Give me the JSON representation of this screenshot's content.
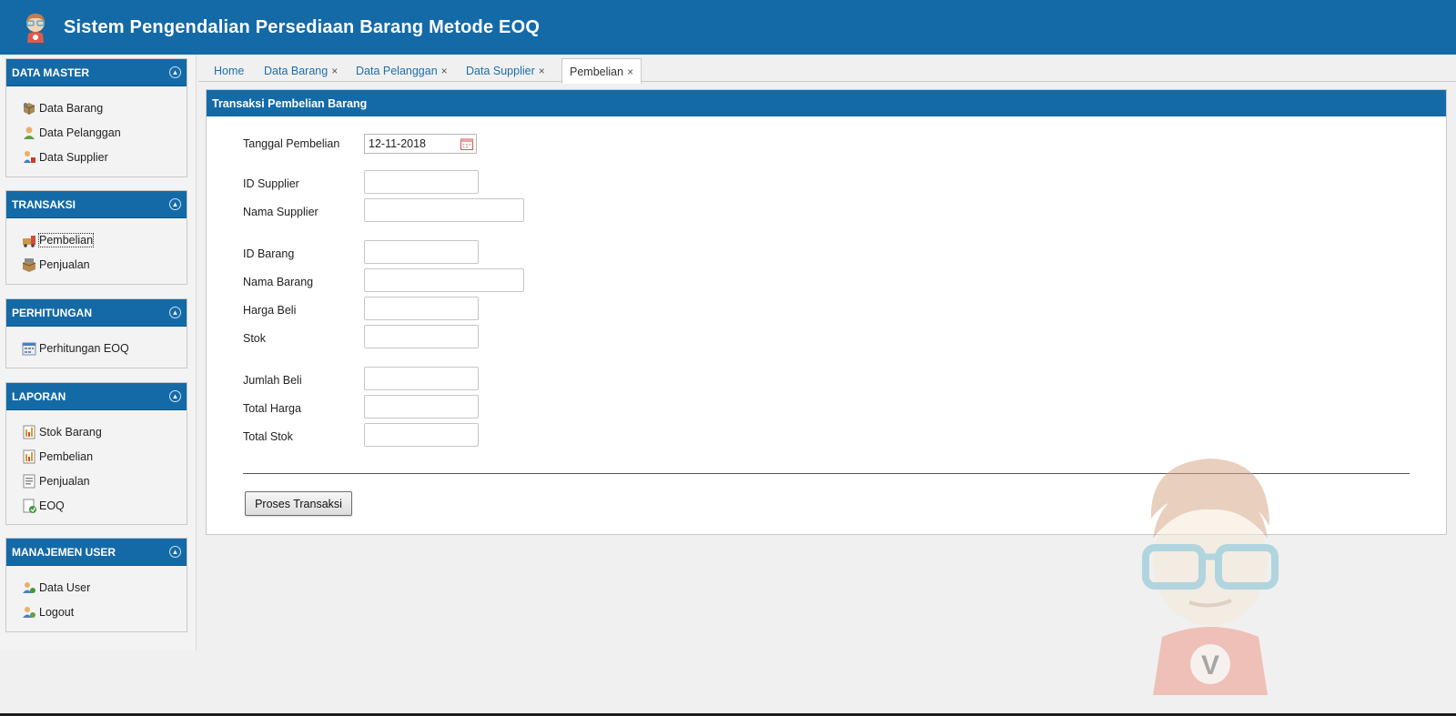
{
  "header": {
    "title": "Sistem Pengendalian Persediaan Barang Metode EOQ",
    "logo_icon": "avatar-logo-icon",
    "bg_color": "#146aa7"
  },
  "sidebar": {
    "panels": [
      {
        "title": "DATA MASTER",
        "items": [
          {
            "label": "Data Barang",
            "icon": "package-icon"
          },
          {
            "label": "Data Pelanggan",
            "icon": "customer-icon"
          },
          {
            "label": "Data Supplier",
            "icon": "supplier-icon"
          }
        ]
      },
      {
        "title": "TRANSAKSI",
        "items": [
          {
            "label": "Pembelian",
            "icon": "purchase-icon"
          },
          {
            "label": "Penjualan",
            "icon": "sale-icon"
          }
        ]
      },
      {
        "title": "PERHITUNGAN",
        "items": [
          {
            "label": "Perhitungan EOQ",
            "icon": "calculator-icon"
          }
        ]
      },
      {
        "title": "LAPORAN",
        "items": [
          {
            "label": "Stok Barang",
            "icon": "report-icon"
          },
          {
            "label": "Pembelian",
            "icon": "report-icon"
          },
          {
            "label": "Penjualan",
            "icon": "report-icon"
          },
          {
            "label": "EOQ",
            "icon": "report-chart-icon"
          }
        ]
      },
      {
        "title": "MANAJEMEN USER",
        "items": [
          {
            "label": "Data User",
            "icon": "user-icon"
          },
          {
            "label": "Logout",
            "icon": "logout-icon"
          }
        ]
      }
    ]
  },
  "tabs": [
    {
      "label": "Home",
      "closable": false
    },
    {
      "label": "Data Barang",
      "closable": true
    },
    {
      "label": "Data Pelanggan",
      "closable": true
    },
    {
      "label": "Data Supplier",
      "closable": true
    },
    {
      "label": "Pembelian",
      "closable": true,
      "active": true
    }
  ],
  "tab_close_glyph": "×",
  "form": {
    "title": "Transaksi Pembelian Barang",
    "tanggal_label": "Tanggal Pembelian",
    "tanggal_value": "12-11-2018",
    "fields": {
      "id_supplier": {
        "label": "ID Supplier",
        "value": ""
      },
      "nama_supplier": {
        "label": "Nama Supplier",
        "value": ""
      },
      "id_barang": {
        "label": "ID Barang",
        "value": ""
      },
      "nama_barang": {
        "label": "Nama Barang",
        "value": ""
      },
      "harga_beli": {
        "label": "Harga Beli",
        "value": ""
      },
      "stok": {
        "label": "Stok",
        "value": ""
      },
      "jumlah_beli": {
        "label": "Jumlah Beli",
        "value": ""
      },
      "total_harga": {
        "label": "Total Harga",
        "value": ""
      },
      "total_stok": {
        "label": "Total Stok",
        "value": ""
      }
    },
    "submit_label": "Proses Transaksi"
  },
  "watermark": {
    "badge_letter": "V",
    "icon": "mascot-watermark-icon"
  }
}
